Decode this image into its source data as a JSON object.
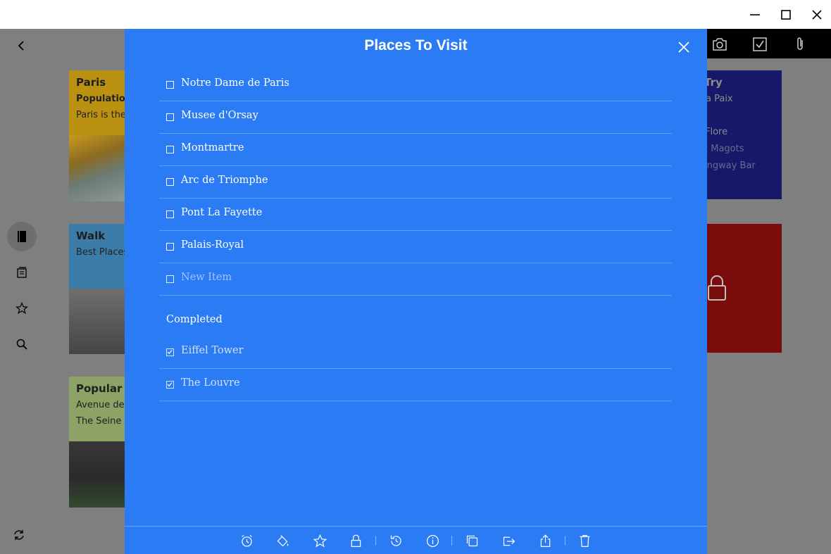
{
  "window": {
    "controls": [
      "minimize-icon",
      "maximize-icon",
      "close-icon"
    ]
  },
  "app": {
    "back_icon": "chevron-left-icon",
    "toolbar_icons": [
      "camera-icon",
      "checkbox-icon",
      "paperclip-icon"
    ],
    "nav": [
      {
        "icon": "notebook-icon",
        "active": true
      },
      {
        "icon": "notes-stack-icon",
        "active": false
      },
      {
        "icon": "star-icon",
        "active": false
      },
      {
        "icon": "search-icon",
        "active": false
      }
    ],
    "sync_icon": "sync-icon"
  },
  "cards": {
    "paris": {
      "title": "Paris",
      "line1": "Population",
      "line2": "Paris is the h",
      "color": "#bb9112"
    },
    "walk": {
      "title": "Walk",
      "line1": "Best Places t",
      "color": "#3b7ca8"
    },
    "popular": {
      "title": "Popular St",
      "line1": "Avenue des",
      "line2": "The Seine",
      "color": "#8da265"
    },
    "try": {
      "title": "Try",
      "line1": "a Paix",
      "line2": "Flore",
      "line3": "t Magots",
      "line4": "ingway Bar",
      "color": "#16196a"
    },
    "locked": {
      "color": "#7a0c0c",
      "icon": "lock-icon"
    }
  },
  "note": {
    "title": "Places To Visit",
    "color": "#2b7bf5",
    "items": [
      {
        "text": "Notre Dame de Paris"
      },
      {
        "text": "Musee d'Orsay"
      },
      {
        "text": "Montmartre"
      },
      {
        "text": "Arc de Triomphe"
      },
      {
        "text": "Pont La Fayette"
      },
      {
        "text": "Palais-Royal"
      }
    ],
    "new_item_placeholder": "New Item",
    "completed_label": "Completed",
    "completed": [
      {
        "text": "Eiffel Tower"
      },
      {
        "text": "The Louvre"
      }
    ],
    "toolbar": [
      "alarm-icon",
      "color-fill-icon",
      "star-icon",
      "lock-icon",
      "history-icon",
      "info-icon",
      "copy-icon",
      "move-icon",
      "share-icon",
      "trash-icon"
    ]
  }
}
